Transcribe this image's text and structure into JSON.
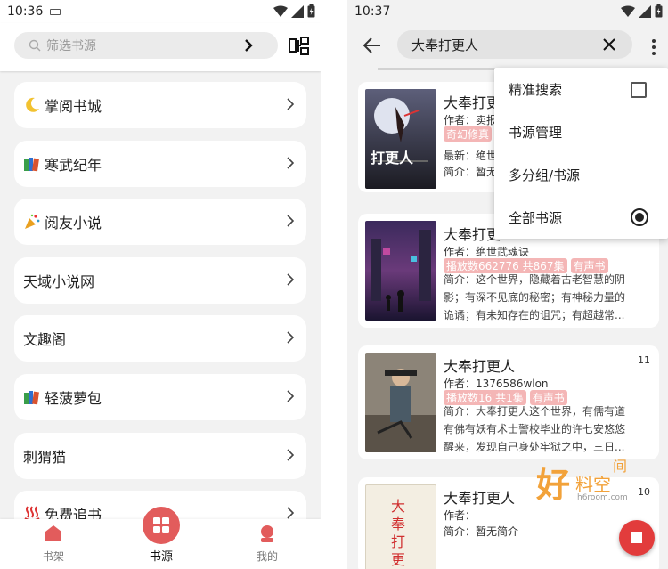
{
  "colors": {
    "accent": "#e25c5c",
    "tag_bg": "#f4b6b6",
    "fab": "#e23c3c"
  },
  "left": {
    "status_time": "10:36",
    "search_placeholder": "筛选书源",
    "sources": [
      {
        "icon": "crescent-moon-icon",
        "name": "掌阅书城"
      },
      {
        "icon": "books-icon",
        "name": "寒武纪年"
      },
      {
        "icon": "party-popper-icon",
        "name": "阅友小说"
      },
      {
        "icon": "",
        "name": "天域小说网"
      },
      {
        "icon": "",
        "name": "文趣阁"
      },
      {
        "icon": "books-icon",
        "name": "轻菠萝包"
      },
      {
        "icon": "",
        "name": "刺猬猫"
      },
      {
        "icon": "hot-springs-icon",
        "name": "免费追书"
      }
    ],
    "nav": {
      "shelf": "书架",
      "sources": "书源",
      "mine": "我的"
    }
  },
  "right": {
    "status_time": "10:37",
    "query": "大奉打更人",
    "menu": [
      {
        "label": "精准搜索",
        "control": "checkbox",
        "checked": false
      },
      {
        "label": "书源管理",
        "control": "none"
      },
      {
        "label": "多分组/书源",
        "control": "none"
      },
      {
        "label": "全部书源",
        "control": "radio",
        "checked": true
      }
    ],
    "books": [
      {
        "title": "大奉打更",
        "author": "作者：卖报",
        "tags": [
          "奇幻修真"
        ],
        "latest": "最新：绝世",
        "desc": "简介：暂无",
        "count": ""
      },
      {
        "title": "大奉打更",
        "author": "作者：绝世武魂诀",
        "tags": [
          "播放数662776 共867集",
          "有声书"
        ],
        "desc": "简介：这个世界，隐藏着古老智慧的阴影；有深不见底的秘密；有神秘力量的诡谲；有未知存在的诅咒；有超越常...",
        "count": ""
      },
      {
        "title": "大奉打更人",
        "author": "作者：1376586wlon",
        "tags": [
          "播放数16 共1集",
          "有声书"
        ],
        "desc": "简介：大奉打更人这个世界，有儒有道有佛有妖有术士警校毕业的许七安悠悠醒来，发现自己身处牢狱之中，三日...",
        "count": "11"
      },
      {
        "title": "大奉打更人",
        "author": "作者：",
        "tags": [],
        "desc": "简介：暂无简介",
        "count": "10"
      }
    ],
    "cover_texts": {
      "c1": "打更人",
      "c4": "大奉打更人"
    },
    "watermark": {
      "big": "好",
      "small": "料空",
      "corner": "间",
      "url": "h6room.com"
    }
  }
}
